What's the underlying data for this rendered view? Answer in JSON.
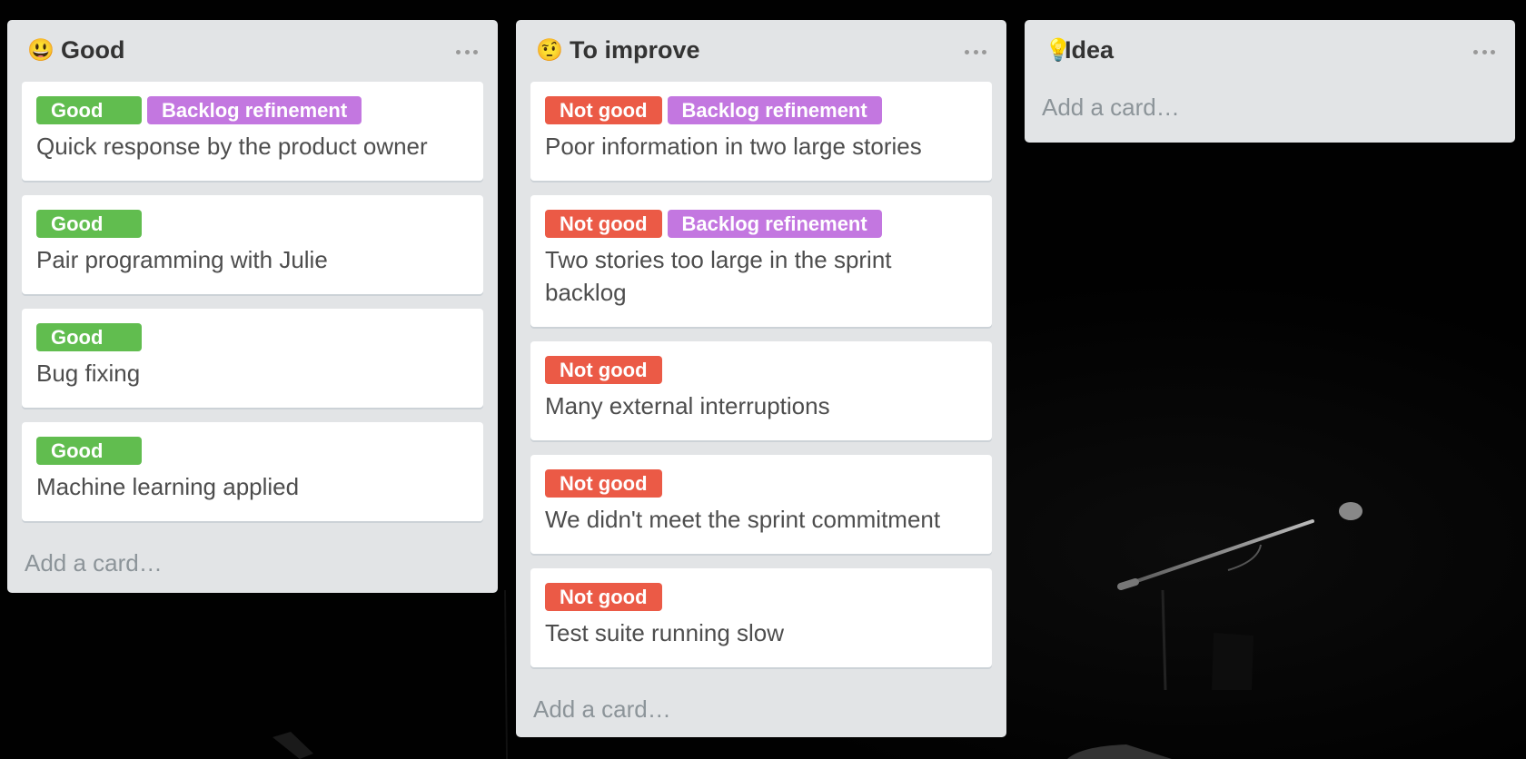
{
  "board": {
    "background": "dark-stage-photo-with-microphone",
    "colors": {
      "list_bg": "#E2E4E6",
      "label_green": "#61BD4F",
      "label_red": "#EB5A46",
      "label_purple": "#C377E0"
    }
  },
  "lists": [
    {
      "emoji": "😃",
      "emoji_name": "smiley-face-icon",
      "title": "Good",
      "menu_icon": "more-horizontal-icon",
      "add_card": "Add a card…",
      "cards": [
        {
          "labels": [
            {
              "text": "Good",
              "color": "green"
            },
            {
              "text": "Backlog refinement",
              "color": "purple"
            }
          ],
          "title": "Quick response by the product owner"
        },
        {
          "labels": [
            {
              "text": "Good",
              "color": "green"
            }
          ],
          "title": "Pair programming with Julie"
        },
        {
          "labels": [
            {
              "text": "Good",
              "color": "green"
            }
          ],
          "title": "Bug fixing"
        },
        {
          "labels": [
            {
              "text": "Good",
              "color": "green"
            }
          ],
          "title": "Machine learning applied"
        }
      ]
    },
    {
      "emoji": "🤨",
      "emoji_name": "raised-eyebrow-face-icon",
      "title": "To improve",
      "menu_icon": "more-horizontal-icon",
      "add_card": "Add a card…",
      "cards": [
        {
          "labels": [
            {
              "text": "Not good",
              "color": "red"
            },
            {
              "text": "Backlog refinement",
              "color": "purple"
            }
          ],
          "title": "Poor information in two large stories"
        },
        {
          "labels": [
            {
              "text": "Not good",
              "color": "red"
            },
            {
              "text": "Backlog refinement",
              "color": "purple"
            }
          ],
          "title": "Two stories too large in the sprint backlog"
        },
        {
          "labels": [
            {
              "text": "Not good",
              "color": "red"
            }
          ],
          "title": "Many external interruptions"
        },
        {
          "labels": [
            {
              "text": "Not good",
              "color": "red"
            }
          ],
          "title": "We didn't meet the sprint commitment"
        },
        {
          "labels": [
            {
              "text": "Not good",
              "color": "red"
            }
          ],
          "title": "Test suite running slow"
        }
      ]
    },
    {
      "emoji": "💡",
      "emoji_name": "light-bulb-icon",
      "title": "Idea",
      "menu_icon": "more-horizontal-icon",
      "add_card": "Add a card…",
      "cards": []
    }
  ]
}
